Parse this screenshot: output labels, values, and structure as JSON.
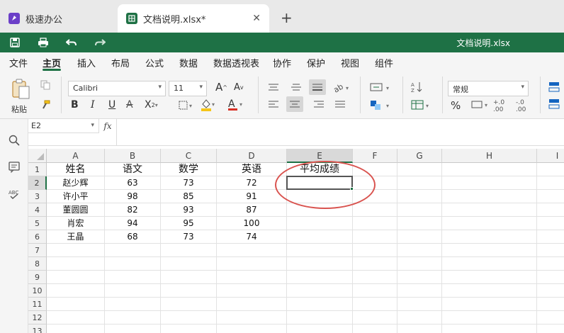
{
  "tabs": [
    {
      "label": "极速办公",
      "icon": "rocket-icon"
    },
    {
      "label": "文档说明.xlsx*",
      "icon": "spreadsheet-icon",
      "active": true
    }
  ],
  "titlebar": {
    "document": "文档说明.xlsx"
  },
  "menu": [
    "文件",
    "主页",
    "插入",
    "布局",
    "公式",
    "数据",
    "数据透视表",
    "协作",
    "保护",
    "视图",
    "组件"
  ],
  "menu_active_index": 1,
  "ribbon": {
    "paste_label": "粘贴",
    "font_name": "Calibri",
    "font_size": "11",
    "number_format": "常规",
    "font_color": "#d93025",
    "fill_color": "#f5c518"
  },
  "formula_bar": {
    "name_box": "E2",
    "fx": "fx",
    "content": ""
  },
  "sheet": {
    "columns": [
      "A",
      "B",
      "C",
      "D",
      "E",
      "F",
      "G",
      "H",
      "I"
    ],
    "selected_column": "E",
    "rows": [
      {
        "n": "1",
        "cells": [
          "姓名",
          "语文",
          "数学",
          "英语",
          "平均成绩"
        ]
      },
      {
        "n": "2",
        "cells": [
          "赵少辉",
          "63",
          "73",
          "72",
          ""
        ]
      },
      {
        "n": "3",
        "cells": [
          "许小平",
          "98",
          "85",
          "91",
          ""
        ]
      },
      {
        "n": "4",
        "cells": [
          "董圆圆",
          "82",
          "93",
          "87",
          ""
        ]
      },
      {
        "n": "5",
        "cells": [
          "肖宏",
          "94",
          "95",
          "100",
          ""
        ]
      },
      {
        "n": "6",
        "cells": [
          "王晶",
          "68",
          "73",
          "74",
          ""
        ]
      },
      {
        "n": "7",
        "cells": []
      },
      {
        "n": "8",
        "cells": []
      },
      {
        "n": "9",
        "cells": []
      },
      {
        "n": "10",
        "cells": []
      },
      {
        "n": "11",
        "cells": []
      },
      {
        "n": "12",
        "cells": []
      },
      {
        "n": "13",
        "cells": []
      }
    ],
    "selected_cell": "E2",
    "annotation_color": "#d9534f"
  }
}
